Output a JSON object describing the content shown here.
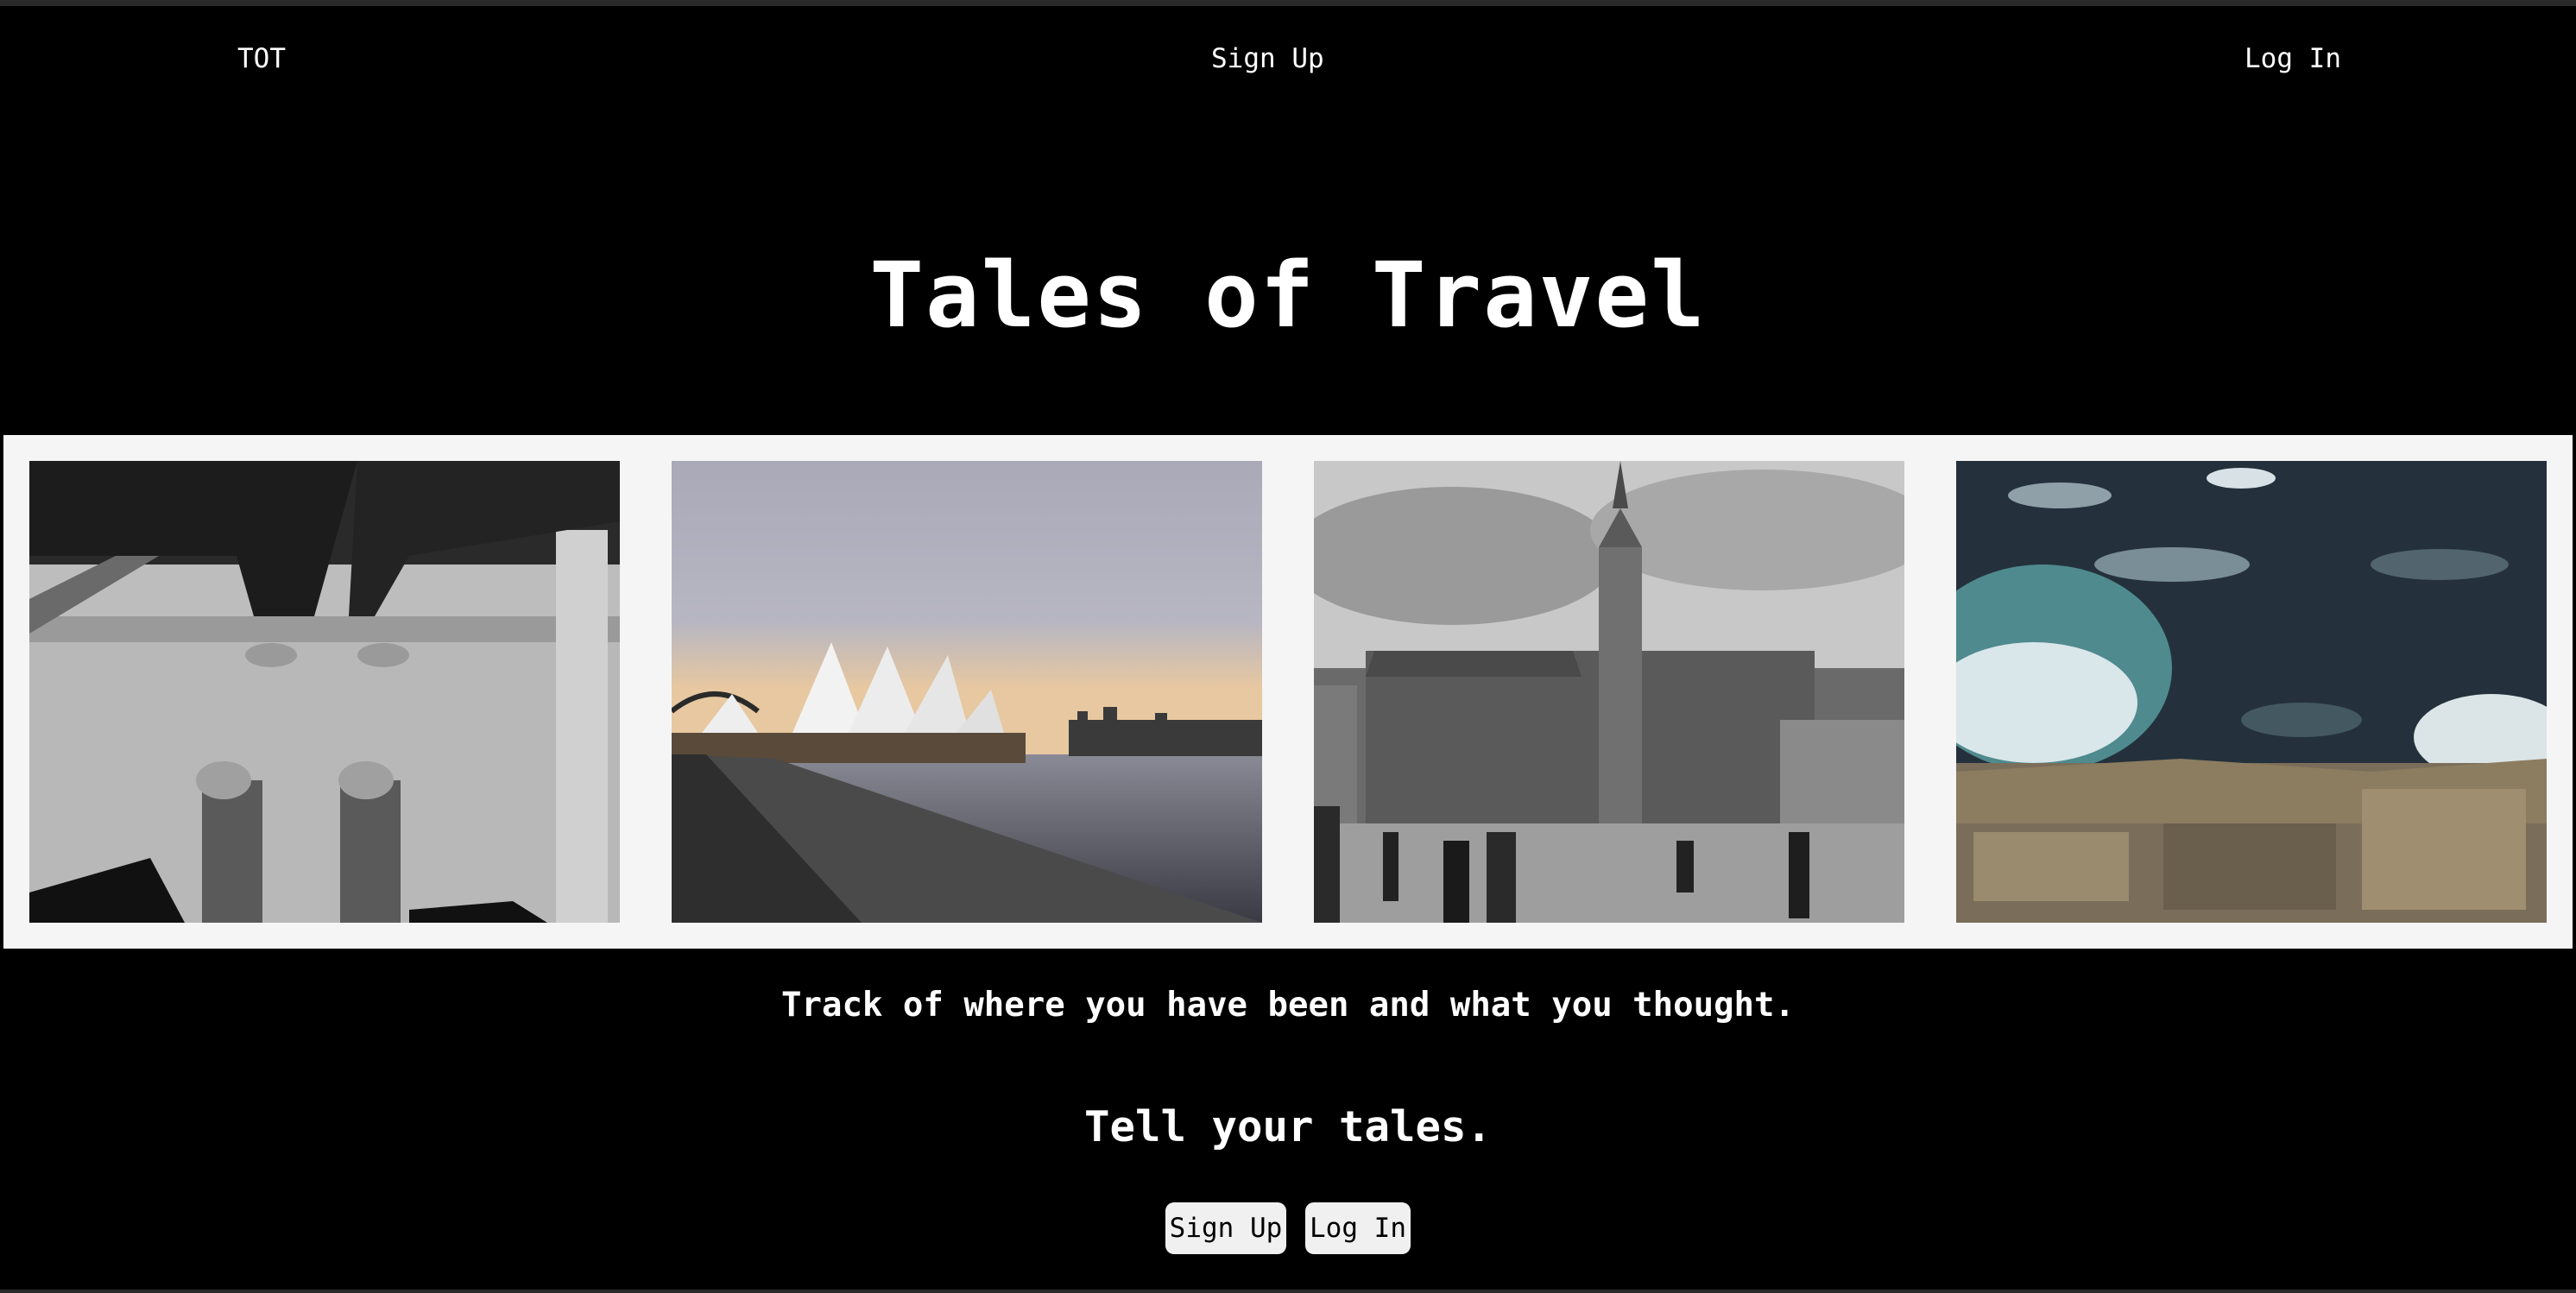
{
  "nav": {
    "brand": "TOT",
    "signup": "Sign Up",
    "login": "Log In"
  },
  "hero": {
    "title": "Tales of Travel"
  },
  "gallery": {
    "photos": [
      {
        "icon": "glass-floor-feet-photo"
      },
      {
        "icon": "opera-house-harbour-photo"
      },
      {
        "icon": "gothic-town-hall-square-photo"
      },
      {
        "icon": "ocean-waves-rocks-photo"
      }
    ]
  },
  "content": {
    "tagline": "Track of where you have been and what you thought.",
    "cta_title": "Tell your tales.",
    "signup_button": "Sign Up",
    "login_button": "Log In"
  },
  "colors": {
    "background": "#000000",
    "gallery_background": "#f5f5f5",
    "text": "#ffffff",
    "button_background": "#f0f0f0",
    "button_text": "#000000"
  }
}
